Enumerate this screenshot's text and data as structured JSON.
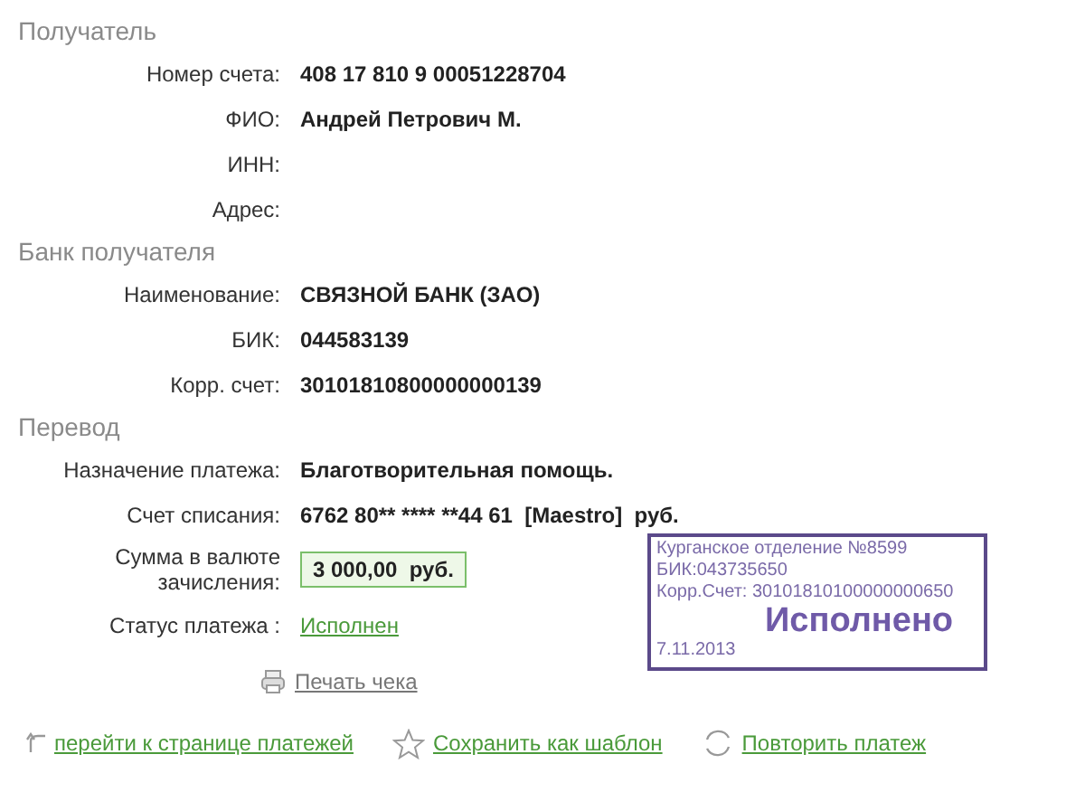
{
  "sections": [
    {
      "title": "Получатель",
      "rows": [
        {
          "label": "Номер счета:",
          "value": "408 17 810 9 00051228704",
          "kind": "text"
        },
        {
          "label": "ФИО:",
          "value": "Андрей Петрович М.",
          "kind": "text"
        },
        {
          "label": "ИНН:",
          "kind": "empty"
        },
        {
          "label": "Адрес:",
          "kind": "empty"
        }
      ]
    },
    {
      "title": "Банк получателя",
      "rows": [
        {
          "label": "Наименование:",
          "value": "СВЯЗНОЙ БАНК (ЗАО)",
          "kind": "text"
        },
        {
          "label": "БИК:",
          "value": "044583139",
          "kind": "text"
        },
        {
          "label": "Корр. счет:",
          "value": "30101810800000000139",
          "kind": "text"
        }
      ]
    },
    {
      "title": "Перевод",
      "rows": [
        {
          "label": "Назначение платежа:",
          "value": "Благотворительная помощь.",
          "kind": "text"
        },
        {
          "label": "Счет списания:",
          "value": "6762 80** **** **44 61  [Maestro]  руб.",
          "kind": "text"
        },
        {
          "label": "Сумма в валюте зачисления:",
          "value": "3 000,00  руб.",
          "kind": "amount"
        },
        {
          "label": "Статус платежа :",
          "value": "Исполнен",
          "kind": "status"
        }
      ]
    }
  ],
  "stamp": {
    "lines": [
      "Курганское отделение №8599",
      "БИК:043735650",
      "Корр.Счет: 30101810100000000650"
    ],
    "title": "Исполнено",
    "date": "7.11.2013"
  },
  "print": {
    "label": "Печать чека"
  },
  "actions": [
    {
      "label": "перейти к странице платежей",
      "kind": "back"
    },
    {
      "label": "Сохранить как шаблон",
      "kind": "star"
    },
    {
      "label": "Повторить платеж",
      "kind": "repeat"
    }
  ]
}
